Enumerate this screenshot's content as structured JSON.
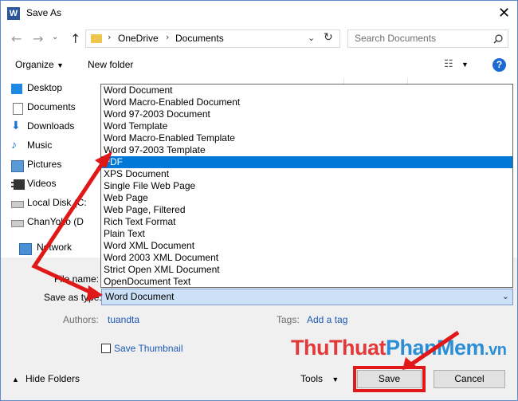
{
  "window": {
    "title": "Save As",
    "app_icon_letter": "W"
  },
  "address": {
    "crumbs": [
      "OneDrive",
      "Documents"
    ],
    "search_placeholder": "Search Documents"
  },
  "toolbar": {
    "organize": "Organize",
    "new_folder": "New folder",
    "help": "?"
  },
  "nav": [
    {
      "label": "Desktop",
      "icon": "desktop-icon"
    },
    {
      "label": "Documents",
      "icon": "documents-icon"
    },
    {
      "label": "Downloads",
      "icon": "downloads-icon"
    },
    {
      "label": "Music",
      "icon": "music-icon"
    },
    {
      "label": "Pictures",
      "icon": "pictures-icon"
    },
    {
      "label": "Videos",
      "icon": "videos-icon"
    },
    {
      "label": "Local Disk (C:",
      "icon": "drive-icon"
    },
    {
      "label": "ChanYoko (D",
      "icon": "drive-icon"
    },
    {
      "label": "Network",
      "icon": "network-icon"
    }
  ],
  "form": {
    "filename_label": "File name:",
    "type_label": "Save as type:",
    "type_value": "Word Document",
    "authors_label": "Authors:",
    "authors_value": "tuandta",
    "tags_label": "Tags:",
    "tags_value": "Add a tag",
    "thumbnail_label": "Save Thumbnail",
    "hide_folders": "Hide Folders",
    "tools": "Tools",
    "save": "Save",
    "cancel": "Cancel"
  },
  "type_options": [
    "Word Document",
    "Word Macro-Enabled Document",
    "Word 97-2003 Document",
    "Word Template",
    "Word Macro-Enabled Template",
    "Word 97-2003 Template",
    "PDF",
    "XPS Document",
    "Single File Web Page",
    "Web Page",
    "Web Page, Filtered",
    "Rich Text Format",
    "Plain Text",
    "Word XML Document",
    "Word 2003 XML Document",
    "Strict Open XML Document",
    "OpenDocument Text"
  ],
  "selected_option": "PDF",
  "watermark": {
    "part1": "Thu",
    "part2": "Thuat",
    "part3": "Phan",
    "part4": "Mem",
    "part5": ".vn"
  },
  "colors": {
    "accent": "#0078d7",
    "annotation": "#e01818",
    "selected_bg": "#cce0f7"
  }
}
